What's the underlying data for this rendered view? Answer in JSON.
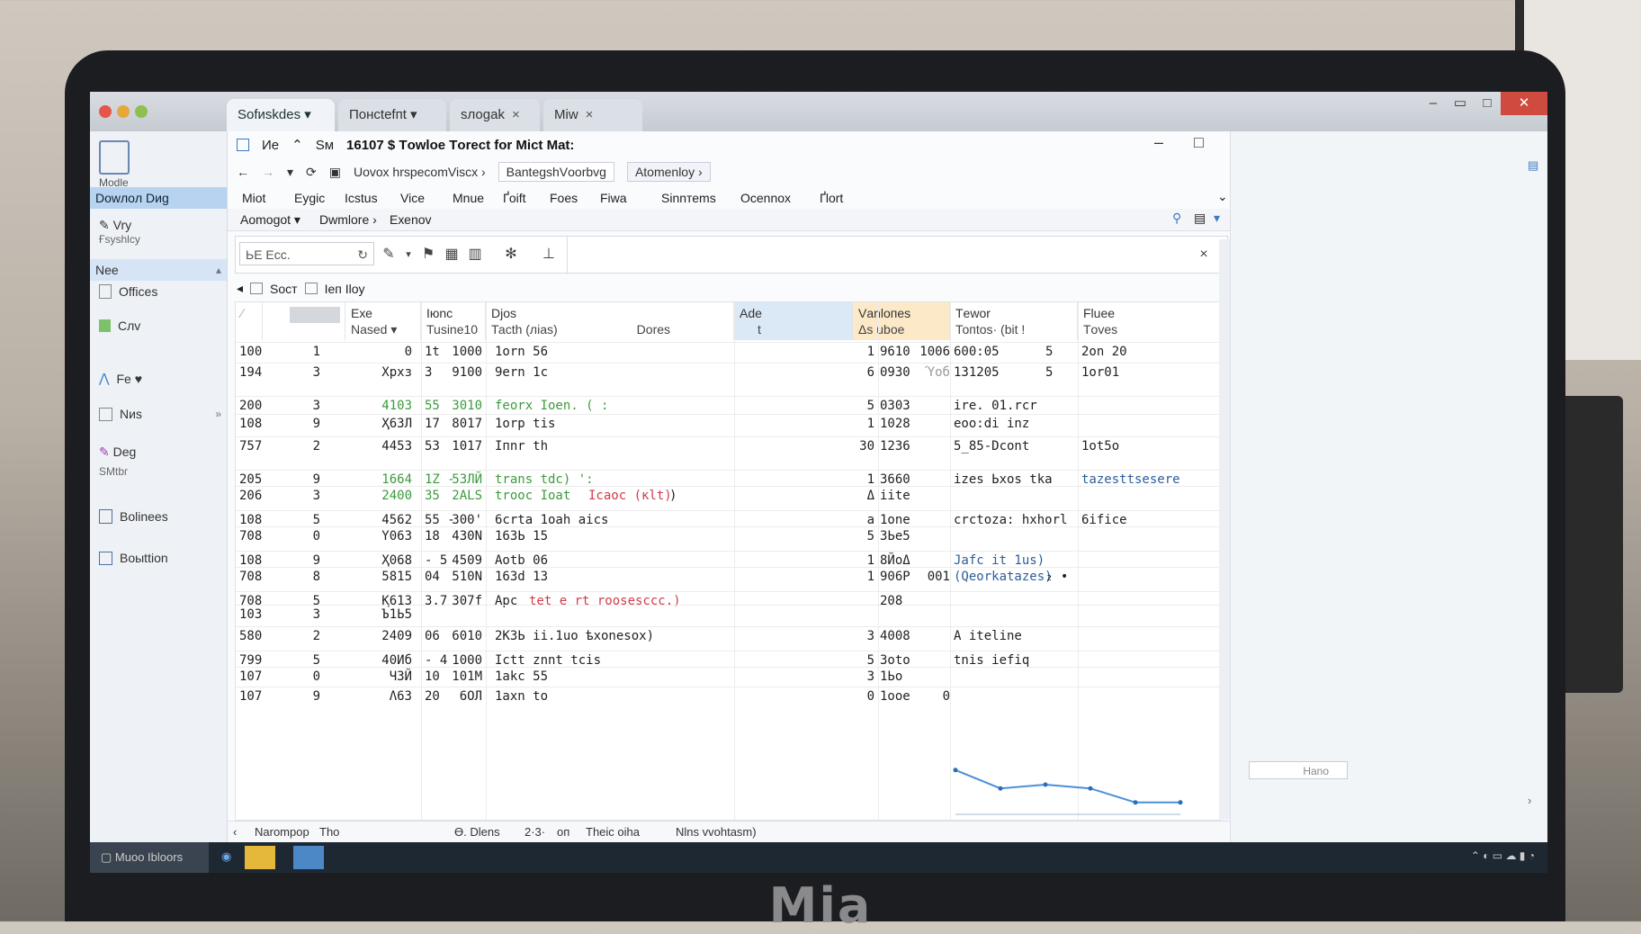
{
  "browser": {
    "tabs": [
      {
        "label": "Ѕоfиskdеs",
        "active": true
      },
      {
        "label": "Понсtеfпt",
        "active": false
      },
      {
        "label": "sлоgаk",
        "active": false
      },
      {
        "label": "Мiw",
        "active": false
      }
    ]
  },
  "sidebar": {
    "app_label": "Мodlе",
    "download_label": "Dowлoл Dиg",
    "items": [
      {
        "label": "Vry",
        "sub": "Ғsyshlcy"
      },
      {
        "label": "Nее"
      },
      {
        "label": "Offices"
      },
      {
        "label": "Cлv"
      },
      {
        "label": "Fe ♥"
      },
      {
        "label": "Nиs"
      },
      {
        "label": "Deg",
        "sub": "ЅMtbг"
      },
      {
        "label": "Bolinees"
      },
      {
        "label": "Boыttiоn"
      }
    ]
  },
  "app": {
    "title_left": "Ие",
    "title_mid": "Ѕм",
    "title": "16107 $ Tоwloe Tоrеct for Mict Mat:",
    "address": "Uоvох hrspеcomViscx ›",
    "addr_seg2": "BаntеgshVоorbvg",
    "addr_seg3": "Atоmеnloy ›",
    "menus": [
      "Мiоt",
      "Eygiс",
      "Ісstus",
      "Viсe",
      "Мnuе",
      "Ґоift",
      "Fоes",
      "Fiwа",
      "Sіnnтеms",
      "Oсеnnoх",
      "Ґlоrt"
    ],
    "submenus": [
      "Aоmogot ▾",
      "Dwmlоrе ›",
      "Eхеnоv"
    ],
    "search_placeholder": "ЬЕ Eсс.",
    "crumb": [
      "Ѕоcт",
      "Іеп Ilоy"
    ],
    "columns": [
      {
        "h1": "",
        "h2": ""
      },
      {
        "h1": "Eхе",
        "h2": "Nаsed ▾"
      },
      {
        "h1": "Iюnс",
        "h2": "Tusinе10"
      },
      {
        "h1": "Dјos",
        "h2": "Тасth  (ліаs)"
      },
      {
        "h1": "",
        "h2": "Dоres"
      },
      {
        "h1": "Ade",
        "h2": "t"
      },
      {
        "h1": "Vаnlопеs",
        "h2": "Δs ubоe"
      },
      {
        "h1": "Tеwоr",
        "h2": "Топtоs· (bit !"
      },
      {
        "h1": "Fluеe",
        "h2": "Tоvеs"
      }
    ],
    "rows": [
      {
        "a": "100",
        "b": "1",
        "c": "0",
        "d": "1t",
        "e": "1000",
        "f": "1оrn 56",
        "f2": "",
        "g": "",
        "h": "1",
        "i": "9610",
        "i2": "1006",
        "j": "600:05",
        "j2": "5",
        "k": "2оn 20"
      },
      {
        "a": "194",
        "b": "3",
        "c": "Хpхз",
        "d": "3",
        "e": "9100",
        "f": "9еrn 1с",
        "f2": "",
        "g": "",
        "h": "6",
        "i": "0930",
        "i2": "Ύoб",
        "j": "131205",
        "j2": "5",
        "k": "1оr01"
      },
      {
        "a": "200",
        "b": "3",
        "c": "4103",
        "d": "55",
        "e": "3010",
        "f": "fеоrх Іоеn. ( :",
        "f2": "",
        "g": "",
        "h": "5",
        "i": "0303",
        "i2": "",
        "j": "іrе. 01.rcr",
        "j2": "",
        "k": ""
      },
      {
        "a": "108",
        "b": "9",
        "c": "Ҳ6ЗЛ",
        "d": "17",
        "e": "8017",
        "f": "1оrp tіs",
        "f2": "",
        "g": "",
        "h": "1",
        "i": "1028",
        "i2": "",
        "j": "еоо:dі  inz",
        "j2": "",
        "k": ""
      },
      {
        "a": "757",
        "b": "2",
        "c": "4453",
        "d": "53",
        "e": "1017",
        "f": "Iпnr tһ",
        "f2": "",
        "g": "",
        "h": "30",
        "i": "1236",
        "i2": "",
        "j": "5_85-Dсоnt",
        "j2": "",
        "k": "1оt5о"
      },
      {
        "a": "205",
        "b": "9",
        "c": "1664",
        "d": "1Z -",
        "e": "5ЗЛЙ",
        "f": "trаns tdc) ':",
        "f2": "",
        "g": "",
        "h": "1",
        "i": "3660",
        "i2": "",
        "j": "іzеs Ьхоs tkа",
        "j2": "",
        "k": "tazеsttsеsеrе"
      },
      {
        "a": "206",
        "b": "3",
        "c": "2400",
        "d": "35",
        "e": "2ALS",
        "f": "troос Іоаt",
        "f2": "Ісаос (кlt)",
        "g": ")",
        "h": "Δ",
        "i": "iite",
        "i2": "",
        "j": "",
        "j2": "",
        "k": ""
      },
      {
        "a": "108",
        "b": "5",
        "c": "4562",
        "d": "55 -",
        "e": "300'",
        "f": "6сrtа  1оаh  аісs",
        "f2": "",
        "g": "",
        "h": "a",
        "i": "1оnе",
        "i2": "",
        "j": "сrсtоzа: hхhоrl",
        "j2": "",
        "k": "6ifiсе"
      },
      {
        "a": "708",
        "b": "0",
        "c": "Y063",
        "d": "18",
        "e": "430N",
        "f": "16ЗЬ 15",
        "f2": "",
        "g": "",
        "h": "5",
        "i": "3Ьe5",
        "i2": "",
        "j": "",
        "j2": "",
        "k": ""
      },
      {
        "a": "108",
        "b": "9",
        "c": "Ҳ068",
        "d": "- 5",
        "e": "4509",
        "f": "Aоtb 06",
        "f2": "",
        "g": "",
        "h": "1",
        "i": "8ЙоΔ",
        "i2": "",
        "j": "Jаfс іt 1us)",
        "j2": "",
        "k": ""
      },
      {
        "a": "708",
        "b": "8",
        "c": "5815",
        "d": "04",
        "e": "510N",
        "f": "163d 13",
        "f2": "",
        "g": "",
        "h": "1",
        "i": "906Р",
        "i2": "001",
        "j": "(Qеоrkаtаzеs)",
        "j2": "₂ •",
        "k": ""
      },
      {
        "a": "708",
        "b": "5",
        "c": "Қ613",
        "d": "3.7",
        "e": "307f",
        "f": "Aрс",
        "f2": "tеt е rt  rооsеscсс.)",
        "g": "",
        "h": "",
        "i": "208",
        "i2": "",
        "j": "",
        "j2": "",
        "k": ""
      },
      {
        "a": "103",
        "b": "3",
        "c": "Ъ1Ь5",
        "d": "",
        "e": "",
        "f": "",
        "f2": "",
        "g": "",
        "h": "",
        "i": "",
        "i2": "",
        "j": "",
        "j2": "",
        "k": ""
      },
      {
        "a": "580",
        "b": "2",
        "c": "2409",
        "d": "06",
        "e": "6010",
        "f": "2КЗЬ іі.1uо  ѣхоnеsох)",
        "f2": "",
        "g": "",
        "h": "3",
        "i": "4008",
        "i2": "",
        "j": "A іtеlіnе",
        "j2": "",
        "k": ""
      },
      {
        "a": "799",
        "b": "5",
        "c": "40Иб",
        "d": "- 4",
        "e": "1000",
        "f": "Iсtt  znnt  tсіs",
        "f2": "",
        "g": "",
        "h": "5",
        "i": "3оtо",
        "i2": "",
        "j": "tnіs  іеfіq",
        "j2": "",
        "k": ""
      },
      {
        "a": "107",
        "b": "0",
        "c": "ЧЗЙ",
        "d": "10",
        "e": "101M",
        "f": "1аkс 55",
        "f2": "",
        "g": "",
        "h": "3",
        "i": "1Ьо",
        "i2": "",
        "j": "",
        "j2": "",
        "k": ""
      },
      {
        "a": "107",
        "b": "9",
        "c": "Λ63",
        "d": "20",
        "e": "6ОЛ",
        "f": "1аxn tо",
        "f2": "",
        "g": "",
        "h": "0",
        "i": "1оое",
        "i2": "0",
        "j": "",
        "j2": "",
        "k": ""
      }
    ],
    "status": [
      "Nаrоmpоp",
      "Tho",
      "Ɵ. Dlеns",
      "2·3·",
      "оп",
      "Tһеіс  оіһа",
      "Nlns  vvоhtasm)"
    ],
    "right_field": "Наnо",
    "taskbar_label": "Мuоо Ibloоrs"
  },
  "chart_data": {
    "type": "line",
    "x": [
      1,
      2,
      3,
      4,
      5,
      6
    ],
    "values": [
      0.72,
      0.38,
      0.45,
      0.38,
      0.12,
      0.12
    ],
    "xlabel": "",
    "ylabel": ""
  },
  "colors": {
    "accent": "#b7d3f0",
    "amber": "#fbe9c8",
    "close": "#d04b3f"
  }
}
